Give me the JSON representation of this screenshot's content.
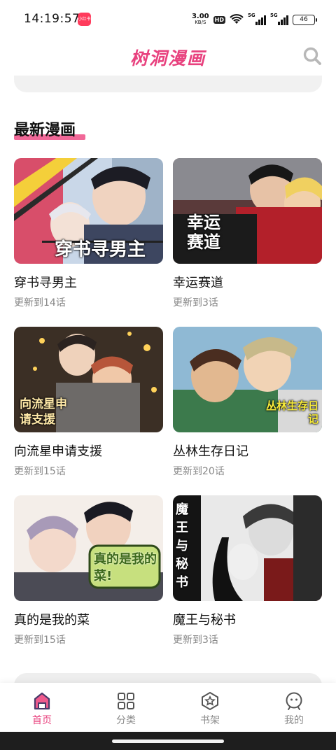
{
  "status_bar": {
    "time": "14:19:57",
    "notification_badge": "小红书",
    "net_speed_value": "3.00",
    "net_speed_unit": "KB/S",
    "hd_label": "HD",
    "signal1_label": "5G",
    "signal2_label": "5G",
    "battery": "46"
  },
  "header": {
    "title": "树洞漫画",
    "search_icon": "search-icon"
  },
  "section": {
    "title": "最新漫画",
    "accent_color": "#ee4d86"
  },
  "comics": [
    {
      "title": "穿书寻男主",
      "update": "更新到14话",
      "cover_text": "穿书寻男主"
    },
    {
      "title": "幸运赛道",
      "update": "更新到3话",
      "cover_text": "幸运赛道"
    },
    {
      "title": "向流星申请支援",
      "update": "更新到15话",
      "cover_text": "向流星申请支援"
    },
    {
      "title": "丛林生存日记",
      "update": "更新到20话",
      "cover_text": "丛林生存日记"
    },
    {
      "title": "真的是我的菜",
      "update": "更新到15话",
      "cover_text": "真的是我的菜!"
    },
    {
      "title": "魔王与秘书",
      "update": "更新到3话",
      "cover_text": "魔王与秘书"
    }
  ],
  "bottom_nav": {
    "items": [
      {
        "label": "首页",
        "icon": "home-icon",
        "active": true
      },
      {
        "label": "分类",
        "icon": "grid-icon",
        "active": false
      },
      {
        "label": "书架",
        "icon": "bookshelf-icon",
        "active": false
      },
      {
        "label": "我的",
        "icon": "profile-icon",
        "active": false
      }
    ],
    "active_color": "#e8417e",
    "inactive_color": "#8a8a8a"
  }
}
